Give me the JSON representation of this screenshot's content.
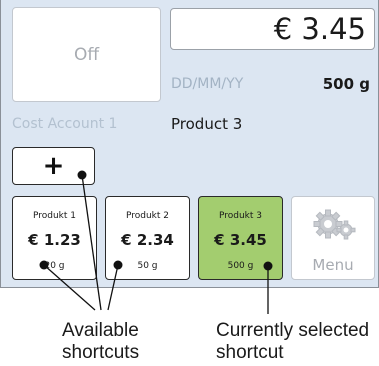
{
  "display": {
    "status_label": "Off",
    "price": "€ 3.45",
    "date_placeholder": "DD/MM/YY",
    "weight": "500 g",
    "cost_account": "Cost Account 1",
    "product": "Product 3"
  },
  "add_button_label": "+",
  "shortcuts": [
    {
      "name": "Produkt 1",
      "price": "€ 1.23",
      "weight": "20 g"
    },
    {
      "name": "Produkt 2",
      "price": "€ 2.34",
      "weight": "50 g"
    },
    {
      "name": "Produkt 3",
      "price": "€ 3.45",
      "weight": "500 g",
      "selected": true
    }
  ],
  "menu": {
    "label": "Menu",
    "icon": "gears-icon"
  },
  "annotations": {
    "available_line1": "Available",
    "available_line2": "shortcuts",
    "selected_line1": "Currently selected",
    "selected_line2": "shortcut"
  },
  "colors": {
    "screen_background": "#dce6f2",
    "selected_shortcut": "#a3cd6f"
  }
}
